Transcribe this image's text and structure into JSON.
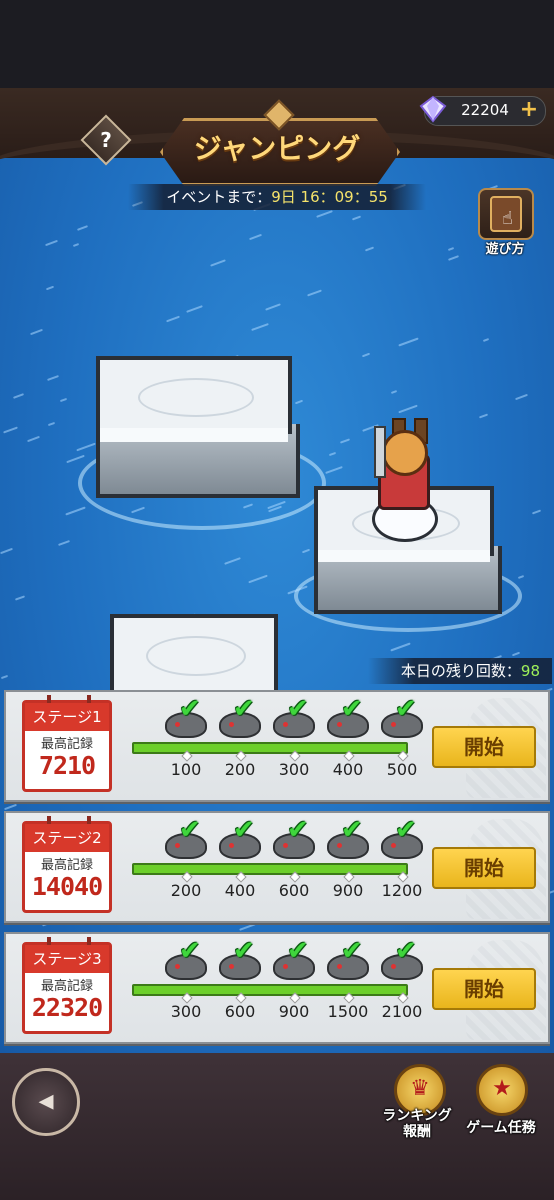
{
  "header": {
    "title": "ジャンピング",
    "help_label": "?",
    "gems": "22204",
    "gem_plus": "+",
    "event_prefix": "イベントまで：",
    "event_days": "9日",
    "event_time": "16：09：55",
    "howto_label": "遊び方"
  },
  "field": {
    "remaining_label": "本日の残り回数：",
    "remaining_count": "98"
  },
  "stages": [
    {
      "name": "ステージ1",
      "record_label": "最高記録",
      "record": "7210",
      "milestones": [
        "100",
        "200",
        "300",
        "400",
        "500"
      ],
      "progress": 1.0,
      "start_label": "開始"
    },
    {
      "name": "ステージ2",
      "record_label": "最高記録",
      "record": "14040",
      "milestones": [
        "200",
        "400",
        "600",
        "900",
        "1200"
      ],
      "progress": 1.0,
      "start_label": "開始"
    },
    {
      "name": "ステージ3",
      "record_label": "最高記録",
      "record": "22320",
      "milestones": [
        "300",
        "600",
        "900",
        "1500",
        "2100"
      ],
      "progress": 1.0,
      "start_label": "開始"
    }
  ],
  "bottom": {
    "back_icon": "back-arrow-icon",
    "ranking_label_1": "ランキング",
    "ranking_label_2": "報酬",
    "tasks_label": "ゲーム任務"
  },
  "colors": {
    "accent_gold": "#f5c542",
    "record_red": "#c0281c",
    "progress_green": "#6ccf2a",
    "check_green": "#3fd63c"
  }
}
